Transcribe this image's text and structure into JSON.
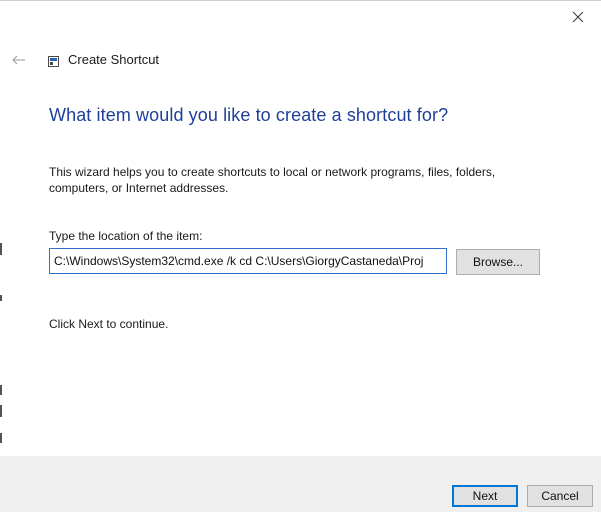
{
  "window": {
    "close_icon": "close-icon",
    "back_icon": "back-arrow-icon"
  },
  "wizard": {
    "icon": "shortcut-wizard-icon",
    "title": "Create Shortcut"
  },
  "content": {
    "heading": "What item would you like to create a shortcut for?",
    "description": "This wizard helps you to create shortcuts to local or network programs, files, folders, computers, or Internet addresses.",
    "location_label": "Type the location of the item:",
    "location_value": "C:\\Windows\\System32\\cmd.exe /k cd C:\\Users\\GiorgyCastaneda\\Proj",
    "browse_label": "Browse...",
    "continue_text": "Click Next to continue."
  },
  "footer": {
    "next_label": "Next",
    "cancel_label": "Cancel"
  },
  "colors": {
    "heading": "#1f3f99",
    "input_focus_border": "#2d6fc9",
    "default_button_border": "#0078d7",
    "footer_bg": "#f0f0f0"
  }
}
